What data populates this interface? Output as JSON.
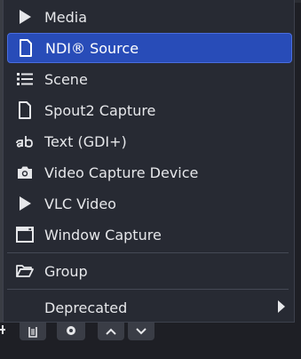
{
  "menu": {
    "items": [
      {
        "label": "Media",
        "icon": "play-icon"
      },
      {
        "label": "NDI® Source",
        "icon": "file-icon"
      },
      {
        "label": "Scene",
        "icon": "list-icon"
      },
      {
        "label": "Spout2 Capture",
        "icon": "file-icon"
      },
      {
        "label": "Text (GDI+)",
        "icon": "text-ab-icon"
      },
      {
        "label": "Video Capture Device",
        "icon": "camera-icon"
      },
      {
        "label": "VLC Video",
        "icon": "play-icon"
      },
      {
        "label": "Window Capture",
        "icon": "window-icon"
      }
    ],
    "group_label": "Group",
    "deprecated_label": "Deprecated",
    "selected_index": 1
  },
  "colors": {
    "menu_bg": "#272a33",
    "selected_bg": "#284cb8",
    "text": "#e6e7ea"
  }
}
